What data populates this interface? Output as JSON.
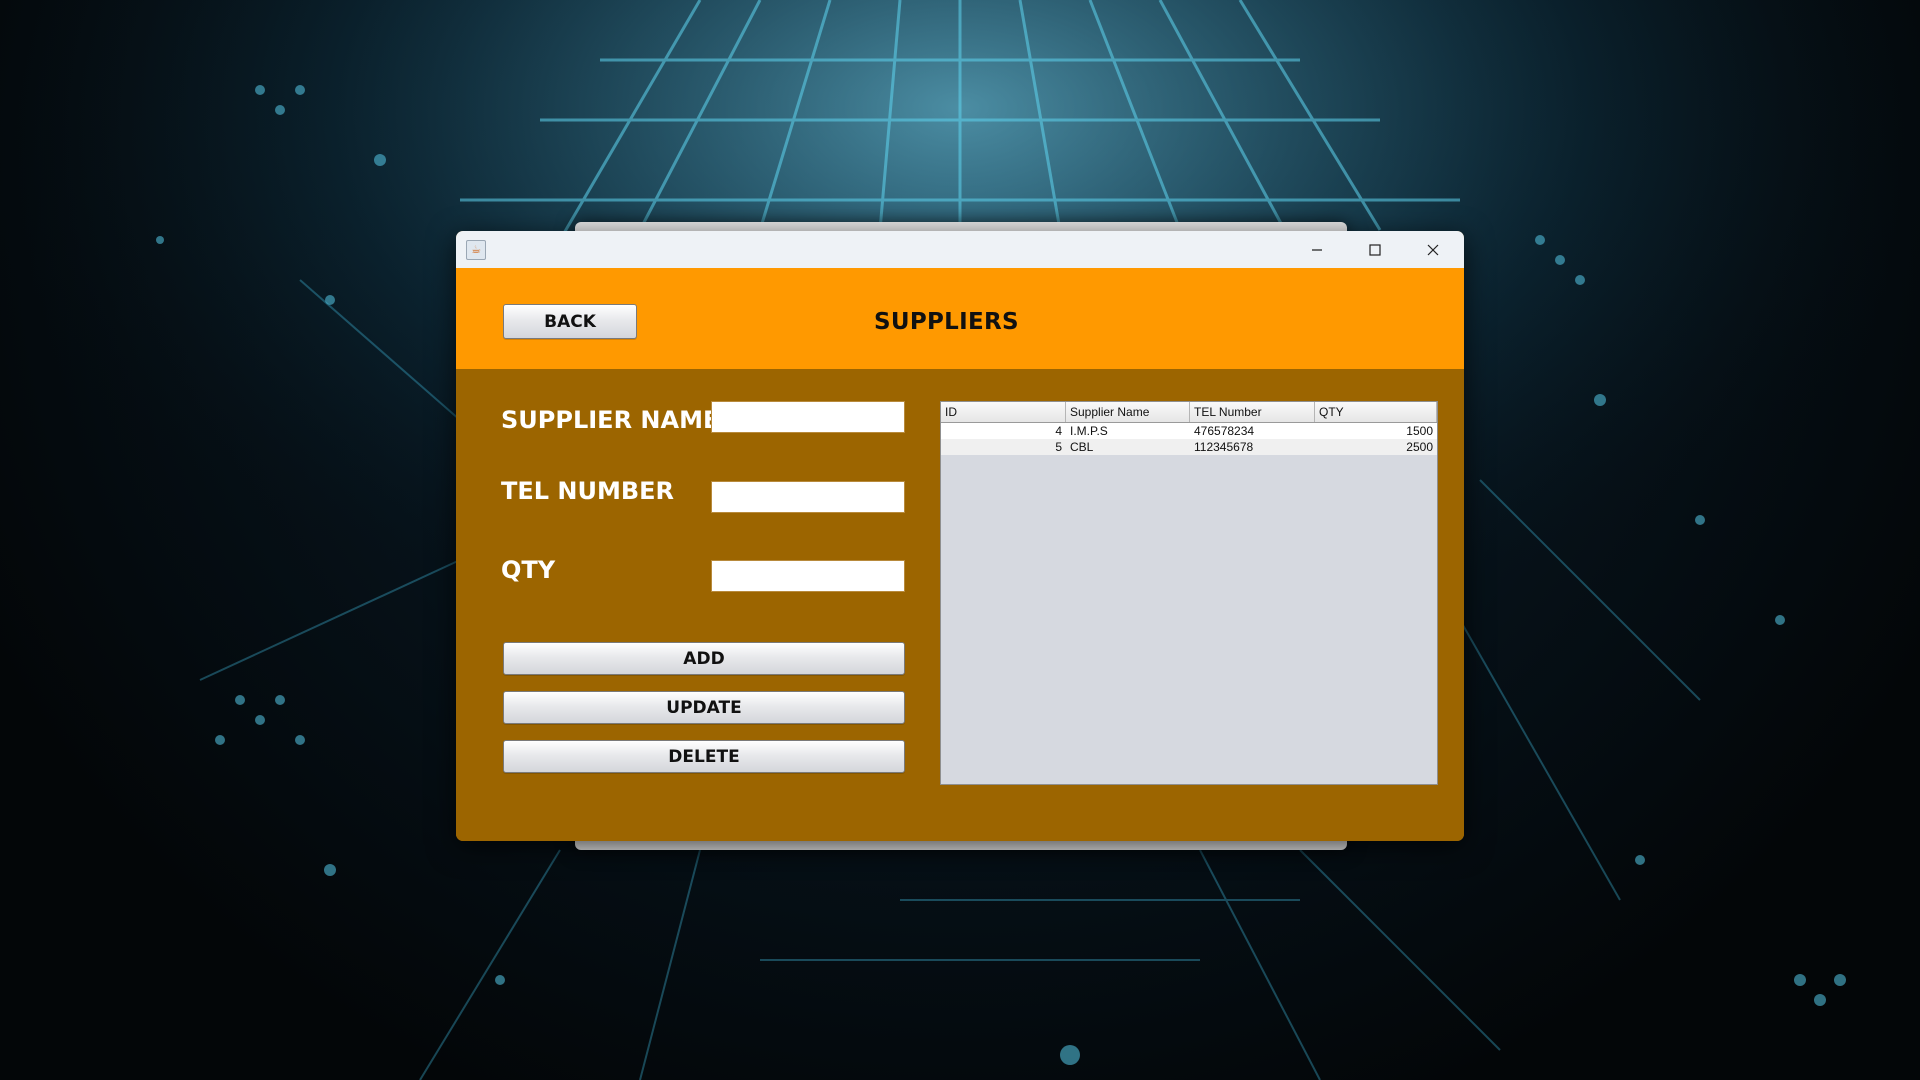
{
  "window": {
    "icon": "java-cup-icon",
    "controls": [
      "minimize-icon",
      "maximize-icon",
      "close-icon"
    ]
  },
  "header": {
    "back_label": "BACK",
    "title": "SUPPLIERS"
  },
  "form": {
    "supplier_name_label": "SUPPLIER NAME",
    "supplier_name_value": "",
    "tel_number_label": "TEL NUMBER",
    "tel_number_value": "",
    "qty_label": "QTY",
    "qty_value": "",
    "add_label": "ADD",
    "update_label": "UPDATE",
    "delete_label": "DELETE"
  },
  "table": {
    "columns": [
      "ID",
      "Supplier Name",
      "TEL Number",
      "QTY"
    ],
    "rows": [
      {
        "id": "4",
        "name": "I.M.P.S",
        "tel": "476578234",
        "qty": "1500"
      },
      {
        "id": "5",
        "name": "CBL",
        "tel": "112345678",
        "qty": "2500"
      }
    ]
  },
  "colors": {
    "header": "#ff9900",
    "body": "#9c6500",
    "table_bg": "#d6d9e0"
  }
}
